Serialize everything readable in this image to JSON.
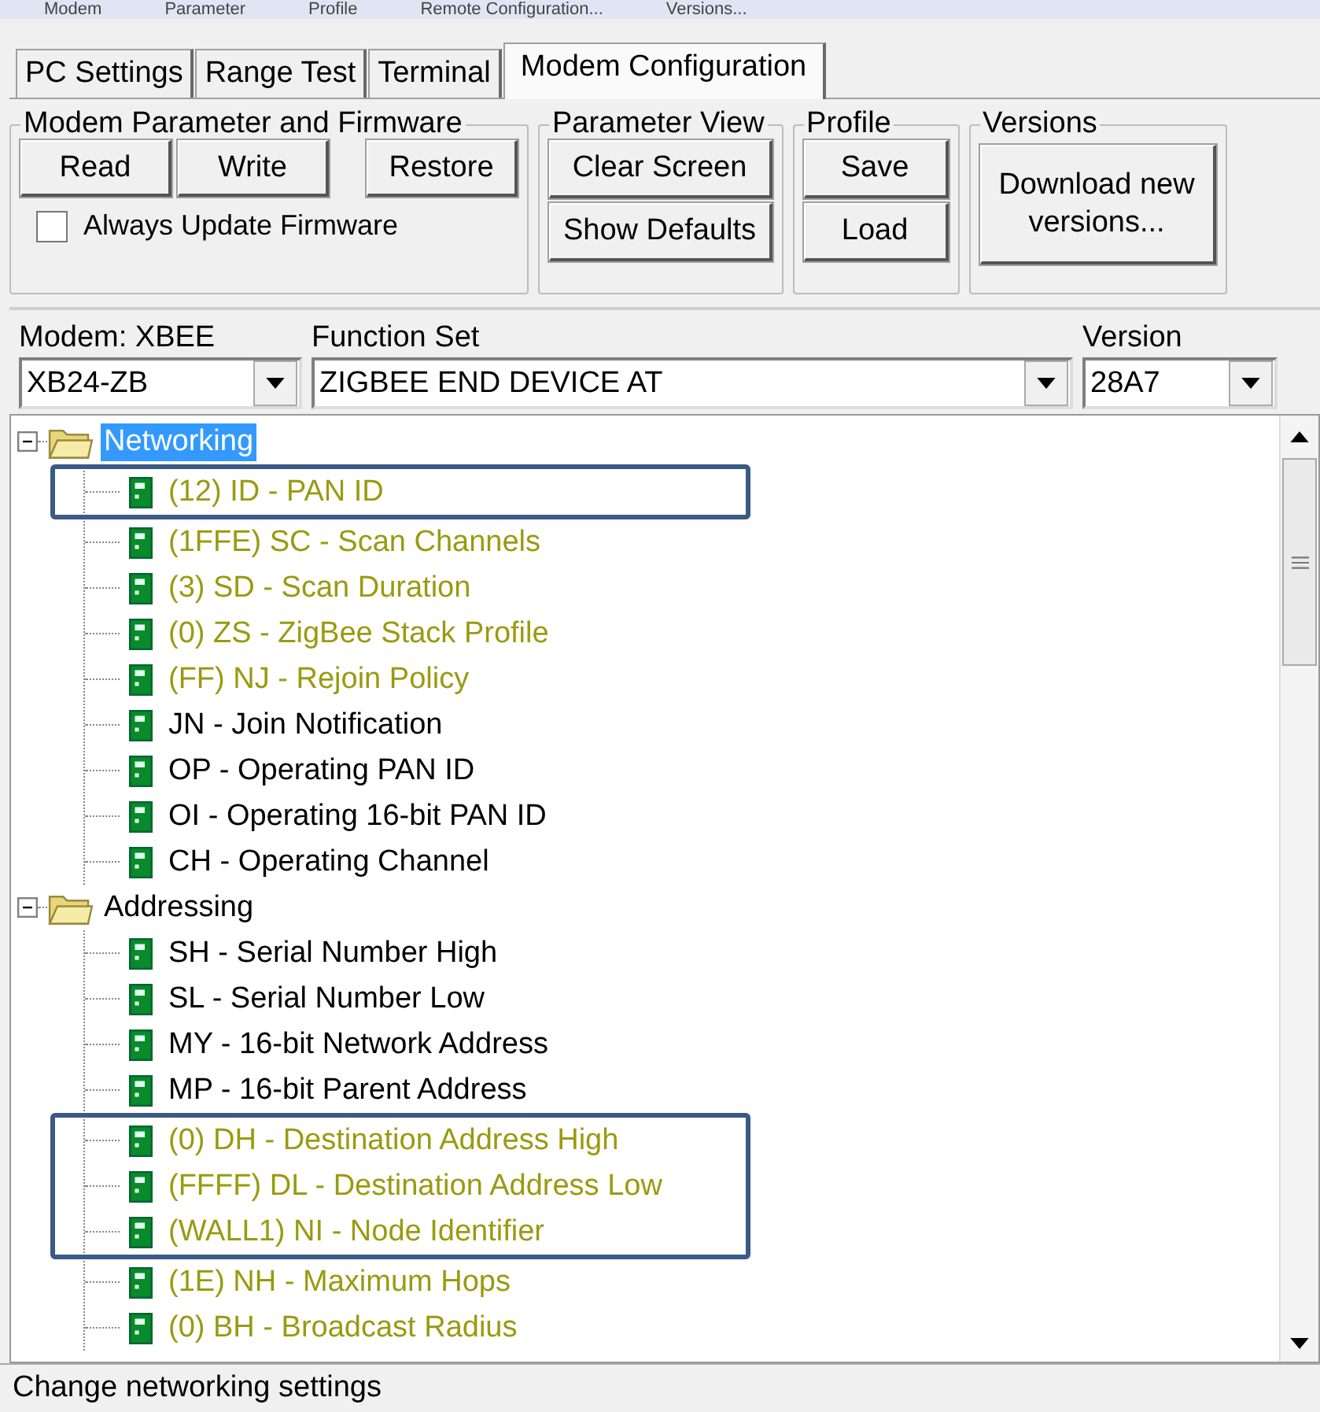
{
  "menu": [
    "Modem",
    "Parameter",
    "Profile",
    "Remote Configuration...",
    "Versions..."
  ],
  "tabs": [
    {
      "label": "PC Settings",
      "selected": false
    },
    {
      "label": "Range Test",
      "selected": false
    },
    {
      "label": "Terminal",
      "selected": false
    },
    {
      "label": "Modem Configuration",
      "selected": true
    }
  ],
  "groups": [
    {
      "title": "Modem Parameter and Firmware",
      "kind": "row",
      "buttons": [
        "Read",
        "Write",
        "Restore"
      ],
      "checkbox": {
        "label": "Always Update Firmware",
        "checked": false
      }
    },
    {
      "title": "Parameter View",
      "kind": "column",
      "buttons": [
        "Clear Screen",
        "Show Defaults"
      ]
    },
    {
      "title": "Profile",
      "kind": "column",
      "buttons": [
        "Save",
        "Load"
      ]
    },
    {
      "title": "Versions",
      "kind": "tall",
      "buttons": [
        "Download new versions..."
      ]
    }
  ],
  "selectors": [
    {
      "label": "Modem: XBEE",
      "value": "XB24-ZB"
    },
    {
      "label": "Function Set",
      "value": "ZIGBEE END DEVICE AT"
    },
    {
      "label": "Version",
      "value": "28A7"
    }
  ],
  "tree": [
    {
      "label": "Networking",
      "selected": true,
      "expanded": true,
      "children": [
        {
          "label": "(12) ID - PAN ID",
          "modified": true,
          "highlighted": true
        },
        {
          "label": "(1FFE) SC - Scan Channels",
          "modified": true,
          "highlighted": false
        },
        {
          "label": "(3) SD - Scan Duration",
          "modified": true,
          "highlighted": false
        },
        {
          "label": "(0) ZS - ZigBee Stack Profile",
          "modified": true,
          "highlighted": false
        },
        {
          "label": "(FF) NJ - Rejoin Policy",
          "modified": true,
          "highlighted": false
        },
        {
          "label": "JN - Join Notification",
          "modified": false,
          "highlighted": false
        },
        {
          "label": "OP - Operating PAN ID",
          "modified": false,
          "highlighted": false
        },
        {
          "label": "OI - Operating 16-bit PAN ID",
          "modified": false,
          "highlighted": false
        },
        {
          "label": "CH - Operating Channel",
          "modified": false,
          "highlighted": false
        }
      ]
    },
    {
      "label": "Addressing",
      "selected": false,
      "expanded": true,
      "children": [
        {
          "label": "SH - Serial Number High",
          "modified": false,
          "highlighted": false
        },
        {
          "label": "SL - Serial Number Low",
          "modified": false,
          "highlighted": false
        },
        {
          "label": "MY - 16-bit Network Address",
          "modified": false,
          "highlighted": false
        },
        {
          "label": "MP - 16-bit Parent Address",
          "modified": false,
          "highlighted": false
        },
        {
          "label": "(0) DH - Destination Address High",
          "modified": true,
          "highlighted": true
        },
        {
          "label": "(FFFF) DL - Destination Address Low",
          "modified": true,
          "highlighted": true
        },
        {
          "label": "(WALL1) NI - Node Identifier",
          "modified": true,
          "highlighted": true
        },
        {
          "label": "(1E) NH - Maximum Hops",
          "modified": true,
          "highlighted": false
        },
        {
          "label": "(0) BH - Broadcast Radius",
          "modified": true,
          "highlighted": false
        }
      ]
    }
  ],
  "status_bar": "Change networking settings"
}
